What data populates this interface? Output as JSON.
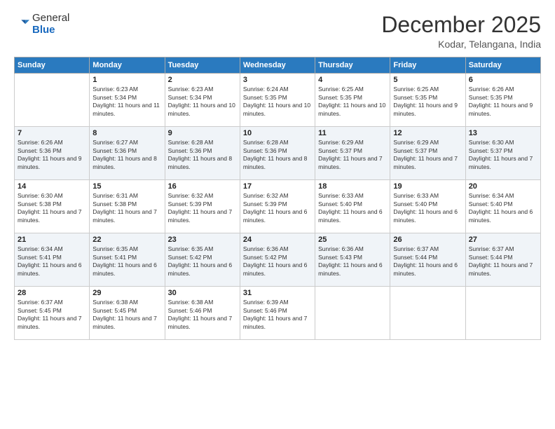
{
  "logo": {
    "general": "General",
    "blue": "Blue"
  },
  "header": {
    "month": "December 2025",
    "location": "Kodar, Telangana, India"
  },
  "days_of_week": [
    "Sunday",
    "Monday",
    "Tuesday",
    "Wednesday",
    "Thursday",
    "Friday",
    "Saturday"
  ],
  "weeks": [
    [
      {
        "day": "",
        "sunrise": "",
        "sunset": "",
        "daylight": ""
      },
      {
        "day": "1",
        "sunrise": "Sunrise: 6:23 AM",
        "sunset": "Sunset: 5:34 PM",
        "daylight": "Daylight: 11 hours and 11 minutes."
      },
      {
        "day": "2",
        "sunrise": "Sunrise: 6:23 AM",
        "sunset": "Sunset: 5:34 PM",
        "daylight": "Daylight: 11 hours and 10 minutes."
      },
      {
        "day": "3",
        "sunrise": "Sunrise: 6:24 AM",
        "sunset": "Sunset: 5:35 PM",
        "daylight": "Daylight: 11 hours and 10 minutes."
      },
      {
        "day": "4",
        "sunrise": "Sunrise: 6:25 AM",
        "sunset": "Sunset: 5:35 PM",
        "daylight": "Daylight: 11 hours and 10 minutes."
      },
      {
        "day": "5",
        "sunrise": "Sunrise: 6:25 AM",
        "sunset": "Sunset: 5:35 PM",
        "daylight": "Daylight: 11 hours and 9 minutes."
      },
      {
        "day": "6",
        "sunrise": "Sunrise: 6:26 AM",
        "sunset": "Sunset: 5:35 PM",
        "daylight": "Daylight: 11 hours and 9 minutes."
      }
    ],
    [
      {
        "day": "7",
        "sunrise": "Sunrise: 6:26 AM",
        "sunset": "Sunset: 5:36 PM",
        "daylight": "Daylight: 11 hours and 9 minutes."
      },
      {
        "day": "8",
        "sunrise": "Sunrise: 6:27 AM",
        "sunset": "Sunset: 5:36 PM",
        "daylight": "Daylight: 11 hours and 8 minutes."
      },
      {
        "day": "9",
        "sunrise": "Sunrise: 6:28 AM",
        "sunset": "Sunset: 5:36 PM",
        "daylight": "Daylight: 11 hours and 8 minutes."
      },
      {
        "day": "10",
        "sunrise": "Sunrise: 6:28 AM",
        "sunset": "Sunset: 5:36 PM",
        "daylight": "Daylight: 11 hours and 8 minutes."
      },
      {
        "day": "11",
        "sunrise": "Sunrise: 6:29 AM",
        "sunset": "Sunset: 5:37 PM",
        "daylight": "Daylight: 11 hours and 7 minutes."
      },
      {
        "day": "12",
        "sunrise": "Sunrise: 6:29 AM",
        "sunset": "Sunset: 5:37 PM",
        "daylight": "Daylight: 11 hours and 7 minutes."
      },
      {
        "day": "13",
        "sunrise": "Sunrise: 6:30 AM",
        "sunset": "Sunset: 5:37 PM",
        "daylight": "Daylight: 11 hours and 7 minutes."
      }
    ],
    [
      {
        "day": "14",
        "sunrise": "Sunrise: 6:30 AM",
        "sunset": "Sunset: 5:38 PM",
        "daylight": "Daylight: 11 hours and 7 minutes."
      },
      {
        "day": "15",
        "sunrise": "Sunrise: 6:31 AM",
        "sunset": "Sunset: 5:38 PM",
        "daylight": "Daylight: 11 hours and 7 minutes."
      },
      {
        "day": "16",
        "sunrise": "Sunrise: 6:32 AM",
        "sunset": "Sunset: 5:39 PM",
        "daylight": "Daylight: 11 hours and 7 minutes."
      },
      {
        "day": "17",
        "sunrise": "Sunrise: 6:32 AM",
        "sunset": "Sunset: 5:39 PM",
        "daylight": "Daylight: 11 hours and 6 minutes."
      },
      {
        "day": "18",
        "sunrise": "Sunrise: 6:33 AM",
        "sunset": "Sunset: 5:40 PM",
        "daylight": "Daylight: 11 hours and 6 minutes."
      },
      {
        "day": "19",
        "sunrise": "Sunrise: 6:33 AM",
        "sunset": "Sunset: 5:40 PM",
        "daylight": "Daylight: 11 hours and 6 minutes."
      },
      {
        "day": "20",
        "sunrise": "Sunrise: 6:34 AM",
        "sunset": "Sunset: 5:40 PM",
        "daylight": "Daylight: 11 hours and 6 minutes."
      }
    ],
    [
      {
        "day": "21",
        "sunrise": "Sunrise: 6:34 AM",
        "sunset": "Sunset: 5:41 PM",
        "daylight": "Daylight: 11 hours and 6 minutes."
      },
      {
        "day": "22",
        "sunrise": "Sunrise: 6:35 AM",
        "sunset": "Sunset: 5:41 PM",
        "daylight": "Daylight: 11 hours and 6 minutes."
      },
      {
        "day": "23",
        "sunrise": "Sunrise: 6:35 AM",
        "sunset": "Sunset: 5:42 PM",
        "daylight": "Daylight: 11 hours and 6 minutes."
      },
      {
        "day": "24",
        "sunrise": "Sunrise: 6:36 AM",
        "sunset": "Sunset: 5:42 PM",
        "daylight": "Daylight: 11 hours and 6 minutes."
      },
      {
        "day": "25",
        "sunrise": "Sunrise: 6:36 AM",
        "sunset": "Sunset: 5:43 PM",
        "daylight": "Daylight: 11 hours and 6 minutes."
      },
      {
        "day": "26",
        "sunrise": "Sunrise: 6:37 AM",
        "sunset": "Sunset: 5:44 PM",
        "daylight": "Daylight: 11 hours and 6 minutes."
      },
      {
        "day": "27",
        "sunrise": "Sunrise: 6:37 AM",
        "sunset": "Sunset: 5:44 PM",
        "daylight": "Daylight: 11 hours and 7 minutes."
      }
    ],
    [
      {
        "day": "28",
        "sunrise": "Sunrise: 6:37 AM",
        "sunset": "Sunset: 5:45 PM",
        "daylight": "Daylight: 11 hours and 7 minutes."
      },
      {
        "day": "29",
        "sunrise": "Sunrise: 6:38 AM",
        "sunset": "Sunset: 5:45 PM",
        "daylight": "Daylight: 11 hours and 7 minutes."
      },
      {
        "day": "30",
        "sunrise": "Sunrise: 6:38 AM",
        "sunset": "Sunset: 5:46 PM",
        "daylight": "Daylight: 11 hours and 7 minutes."
      },
      {
        "day": "31",
        "sunrise": "Sunrise: 6:39 AM",
        "sunset": "Sunset: 5:46 PM",
        "daylight": "Daylight: 11 hours and 7 minutes."
      },
      {
        "day": "",
        "sunrise": "",
        "sunset": "",
        "daylight": ""
      },
      {
        "day": "",
        "sunrise": "",
        "sunset": "",
        "daylight": ""
      },
      {
        "day": "",
        "sunrise": "",
        "sunset": "",
        "daylight": ""
      }
    ]
  ]
}
